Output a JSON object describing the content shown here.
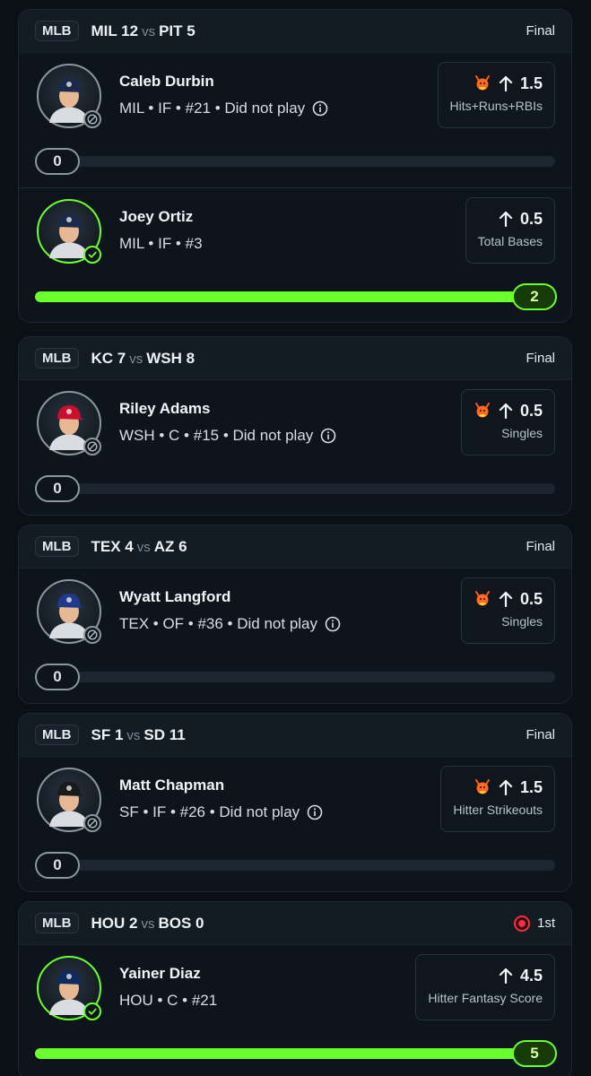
{
  "colors": {
    "accent_green": "#6cff2e",
    "live_red": "#ff2a3c",
    "background": "#0b1016"
  },
  "games": [
    {
      "league": "MLB",
      "away": "MIL 12",
      "vs": "vs",
      "home": "PIT 5",
      "status": "Final",
      "live": false,
      "picks": [
        {
          "name": "Caleb Durbin",
          "meta": "MIL • IF • #21 • Did not play",
          "has_info": true,
          "line": "1.5",
          "stat": "Hits+Runs+RBIs",
          "hot": true,
          "result": "0",
          "progress": 0,
          "hit": false,
          "cap": "MIL"
        },
        {
          "name": "Joey Ortiz",
          "meta": "MIL • IF • #3",
          "has_info": false,
          "line": "0.5",
          "stat": "Total Bases",
          "hot": false,
          "result": "2",
          "progress": 1,
          "hit": true,
          "cap": "MIL"
        }
      ]
    },
    {
      "league": "MLB",
      "away": "KC 7",
      "vs": "vs",
      "home": "WSH 8",
      "status": "Final",
      "live": false,
      "picks": [
        {
          "name": "Riley Adams",
          "meta": "WSH • C • #15 • Did not play",
          "has_info": true,
          "line": "0.5",
          "stat": "Singles",
          "hot": true,
          "result": "0",
          "progress": 0,
          "hit": false,
          "cap": "WSH"
        }
      ]
    },
    {
      "league": "MLB",
      "away": "TEX 4",
      "vs": "vs",
      "home": "AZ 6",
      "status": "Final",
      "live": false,
      "picks": [
        {
          "name": "Wyatt Langford",
          "meta": "TEX • OF • #36 • Did not play",
          "has_info": true,
          "line": "0.5",
          "stat": "Singles",
          "hot": true,
          "result": "0",
          "progress": 0,
          "hit": false,
          "cap": "TEX"
        }
      ]
    },
    {
      "league": "MLB",
      "away": "SF 1",
      "vs": "vs",
      "home": "SD 11",
      "status": "Final",
      "live": false,
      "picks": [
        {
          "name": "Matt Chapman",
          "meta": "SF • IF • #26 • Did not play",
          "has_info": true,
          "line": "1.5",
          "stat": "Hitter Strikeouts",
          "hot": true,
          "result": "0",
          "progress": 0,
          "hit": false,
          "cap": "SF"
        }
      ]
    },
    {
      "league": "MLB",
      "away": "HOU 2",
      "vs": "vs",
      "home": "BOS 0",
      "status": "1st",
      "live": true,
      "picks": [
        {
          "name": "Yainer Diaz",
          "meta": "HOU • C • #21",
          "has_info": false,
          "line": "4.5",
          "stat": "Hitter Fantasy Score",
          "hot": false,
          "result": "5",
          "progress": 1,
          "hit": true,
          "cap": "HOU"
        }
      ]
    }
  ]
}
